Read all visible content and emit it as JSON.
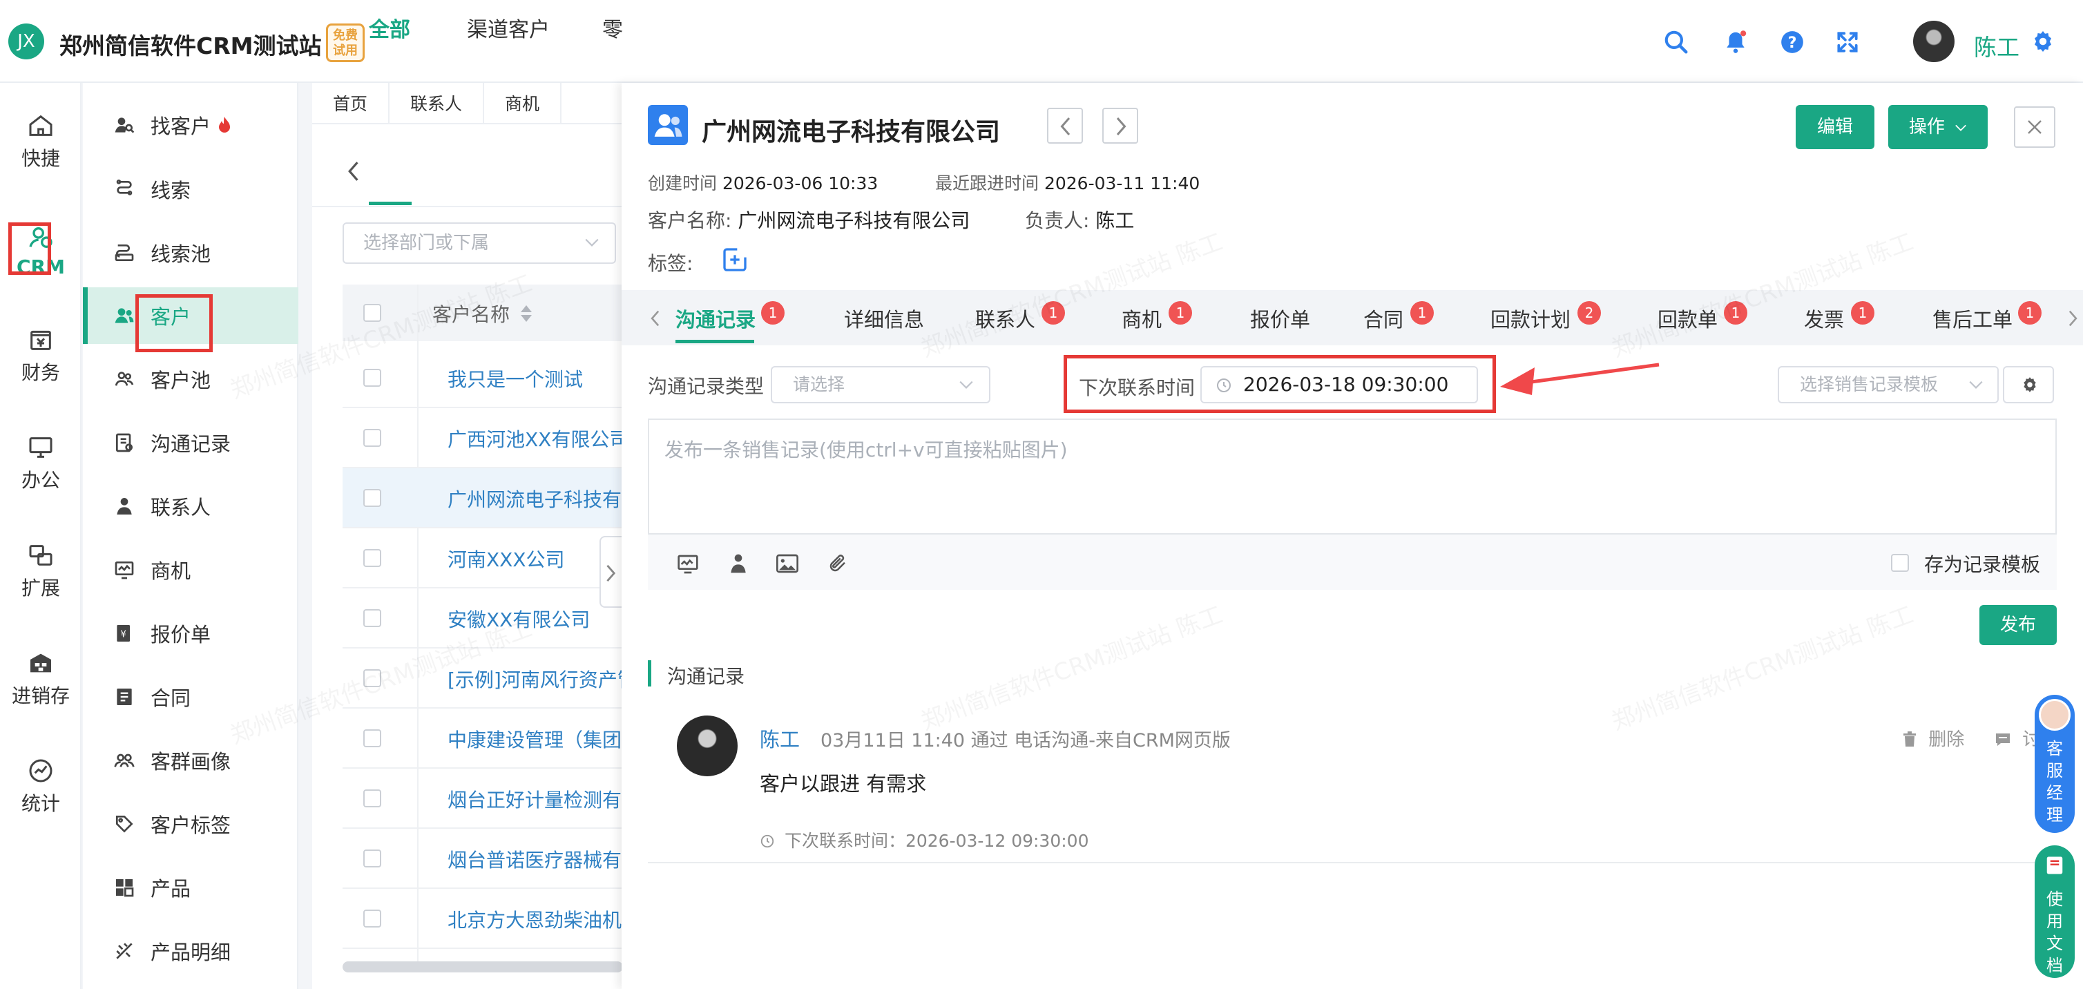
{
  "header": {
    "logo_text": "JX",
    "site_title": "郑州简信软件CRM测试站",
    "trial_badge_line1": "免费",
    "trial_badge_line2": "试用",
    "user_name": "陈工"
  },
  "rail": {
    "items": [
      {
        "label": "快捷",
        "icon": "home-icon"
      },
      {
        "label": "CRM",
        "icon": "crm-icon"
      },
      {
        "label": "财务",
        "icon": "finance-icon"
      },
      {
        "label": "办公",
        "icon": "monitor-icon"
      },
      {
        "label": "扩展",
        "icon": "extend-icon"
      },
      {
        "label": "进销存",
        "icon": "warehouse-icon"
      },
      {
        "label": "统计",
        "icon": "stats-icon"
      }
    ]
  },
  "menu": {
    "items": [
      {
        "label": "找客户"
      },
      {
        "label": "线索"
      },
      {
        "label": "线索池"
      },
      {
        "label": "客户"
      },
      {
        "label": "客户池"
      },
      {
        "label": "沟通记录"
      },
      {
        "label": "联系人"
      },
      {
        "label": "商机"
      },
      {
        "label": "报价单"
      },
      {
        "label": "合同"
      },
      {
        "label": "客群画像"
      },
      {
        "label": "客户标签"
      },
      {
        "label": "产品"
      },
      {
        "label": "产品明细"
      }
    ]
  },
  "list": {
    "crumbs": [
      "首页",
      "联系人",
      "商机"
    ],
    "tabs": [
      "全部",
      "渠道客户",
      "零"
    ],
    "dept_placeholder": "选择部门或下属",
    "column_header": "客户名称",
    "rows": [
      "我只是一个测试",
      "广西河池XX有限公司",
      "广州网流电子科技有",
      "河南XXX公司",
      "安徽XX有限公司",
      "[示例]河南风行资产管",
      "中康建设管理（集团",
      "烟台正好计量检测有",
      "烟台普诺医疗器械有",
      "北京方大恩劲柴油机"
    ]
  },
  "detail": {
    "company_name": "广州网流电子科技有限公司",
    "edit_label": "编辑",
    "ops_label": "操作",
    "created_label": "创建时间",
    "created_value": "2026-03-06 10:33",
    "last_follow_label": "最近跟进时间",
    "last_follow_value": "2026-03-11 11:40",
    "customer_name_label": "客户名称:",
    "customer_name_value": "广州网流电子科技有限公司",
    "owner_label": "负责人:",
    "owner_value": "陈工",
    "tags_label": "标签:",
    "tabs": [
      {
        "label": "沟通记录",
        "badge": "1"
      },
      {
        "label": "详细信息",
        "badge": ""
      },
      {
        "label": "联系人",
        "badge": "1"
      },
      {
        "label": "商机",
        "badge": "1"
      },
      {
        "label": "报价单",
        "badge": ""
      },
      {
        "label": "合同",
        "badge": "1"
      },
      {
        "label": "回款计划",
        "badge": "2"
      },
      {
        "label": "回款单",
        "badge": "1"
      },
      {
        "label": "发票",
        "badge": "1"
      },
      {
        "label": "售后工单",
        "badge": "1"
      }
    ],
    "record_type_label": "沟通记录类型",
    "record_type_placeholder": "请选择",
    "next_contact_label": "下次联系时间",
    "next_contact_value": "2026-03-18 09:30:00",
    "template_placeholder": "选择销售记录模板",
    "editor_placeholder": "发布一条销售记录(使用ctrl+v可直接粘贴图片)",
    "save_template_label": "存为记录模板",
    "publish_label": "发布",
    "section_title": "沟通记录",
    "record": {
      "author": "陈工",
      "meta": "03月11日 11:40 通过 电话沟通-来自CRM网页版",
      "content": "客户以跟进  有需求",
      "next_contact": "下次联系时间：2026-03-12 09:30:00",
      "delete_label": "删除",
      "comment_label": "讨"
    }
  },
  "floats": {
    "manager_label": "客服经理",
    "docs_label": "使用文档"
  },
  "watermark": "郑州简信软件CRM测试站 陈工",
  "colors": {
    "brand": "#1aa784",
    "link": "#2f80c3",
    "badge": "#f05454",
    "annotation": "#e53935"
  }
}
